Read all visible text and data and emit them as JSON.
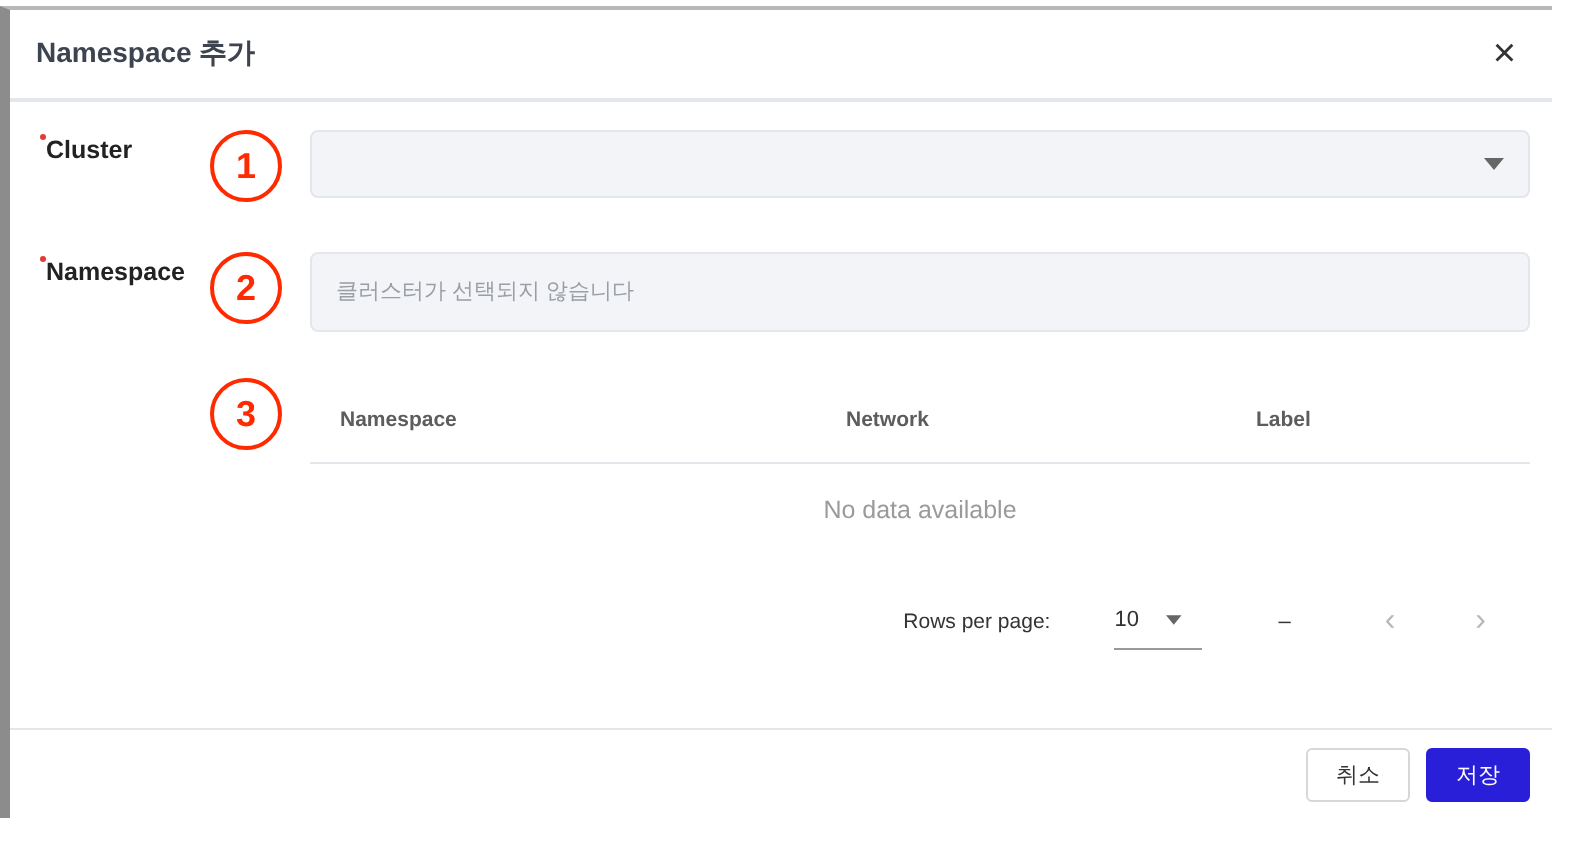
{
  "dialog": {
    "title": "Namespace 추가",
    "close": "×"
  },
  "fields": [
    {
      "label": "Cluster",
      "required": true,
      "marker": "1",
      "kind": "select"
    },
    {
      "label": "Namespace",
      "required": true,
      "marker": "2",
      "kind": "input",
      "placeholder": "클러스터가 선택되지 않습니다"
    }
  ],
  "table": {
    "marker": "3",
    "columns": [
      "Namespace",
      "Network",
      "Label"
    ],
    "empty_text": "No data available"
  },
  "pagination": {
    "rows_label": "Rows per page:",
    "rows_value": "10",
    "range": "–",
    "prev": "‹",
    "next": "›"
  },
  "buttons": [
    {
      "label": "취소",
      "kind": "secondary"
    },
    {
      "label": "저장",
      "kind": "primary"
    }
  ]
}
